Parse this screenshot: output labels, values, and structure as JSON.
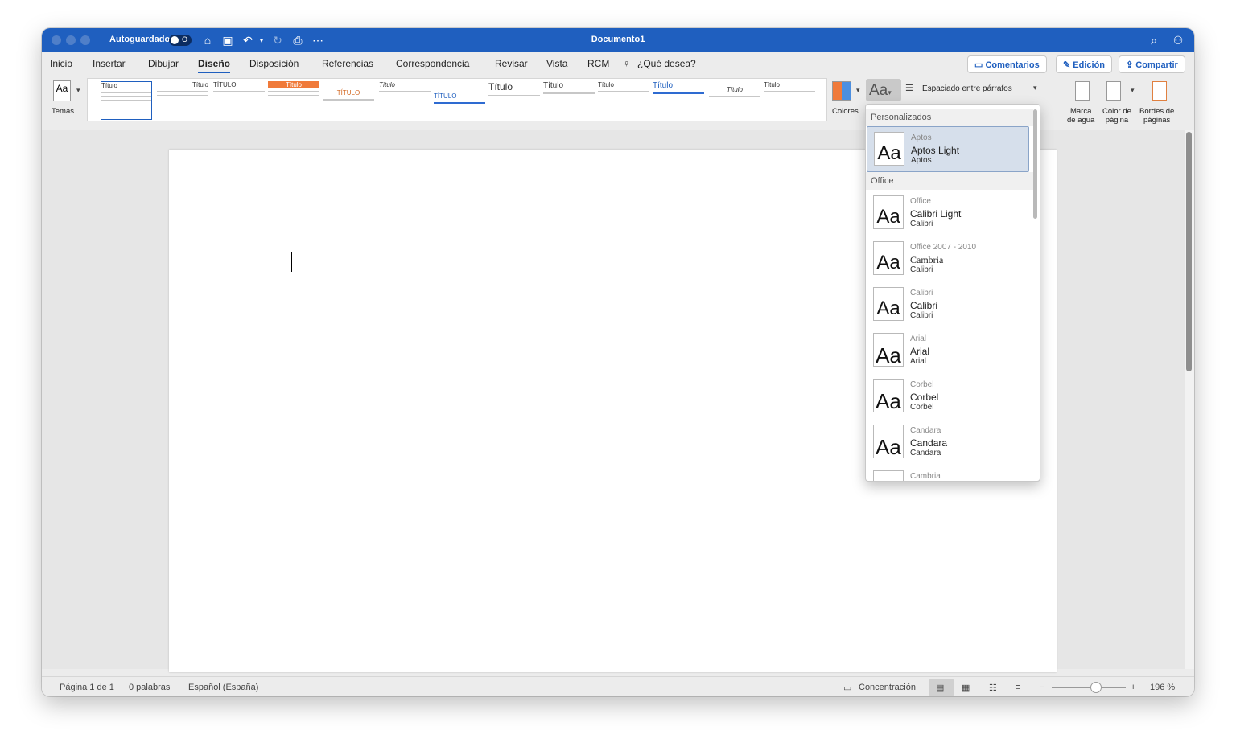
{
  "titlebar": {
    "autosave_label": "Autoguardado",
    "autosave_state": "O",
    "doc_title": "Documento1",
    "icons": [
      "home-icon",
      "save-icon",
      "undo-icon",
      "redo-icon",
      "print-icon",
      "more-icon",
      "search-icon",
      "share-person-icon"
    ]
  },
  "tabs": [
    "Inicio",
    "Insertar",
    "Dibujar",
    "Diseño",
    "Disposición",
    "Referencias",
    "Correspondencia",
    "Revisar",
    "Vista",
    "RCM"
  ],
  "active_tab": "Diseño",
  "tell_me": "¿Qué desea?",
  "top_buttons": {
    "comments": "Comentarios",
    "editing": "Edición",
    "share": "Compartir"
  },
  "ribbon": {
    "themes_label": "Temas",
    "colors_label": "Colores",
    "paragraph_spacing": "Espaciado entre párrafos",
    "watermark": [
      "Marca",
      "de agua"
    ],
    "page_color": [
      "Color de",
      "página"
    ],
    "page_borders": [
      "Bordes de",
      "páginas"
    ],
    "style_titles": [
      "Título",
      "Título",
      "TÍTULO",
      "Título",
      "TÍTULO",
      "Título",
      "TÍTULO",
      "Título",
      "Título",
      "Título",
      "Título",
      "Título",
      "Título"
    ]
  },
  "font_dropdown": {
    "section_custom": "Personalizados",
    "section_office": "Office",
    "custom_items": [
      {
        "theme": "Aptos",
        "heading": "Aptos Light",
        "body": "Aptos"
      }
    ],
    "office_items": [
      {
        "theme": "Office",
        "heading": "Calibri Light",
        "body": "Calibri"
      },
      {
        "theme": "Office 2007 - 2010",
        "heading": "Cambria",
        "body": "Calibri"
      },
      {
        "theme": "Calibri",
        "heading": "Calibri",
        "body": "Calibri"
      },
      {
        "theme": "Arial",
        "heading": "Arial",
        "body": "Arial"
      },
      {
        "theme": "Corbel",
        "heading": "Corbel",
        "body": "Corbel"
      },
      {
        "theme": "Candara",
        "heading": "Candara",
        "body": "Candara"
      },
      {
        "theme": "Cambria",
        "heading": "",
        "body": ""
      }
    ],
    "preview_glyph": "Aa"
  },
  "statusbar": {
    "page": "Página 1 de 1",
    "words": "0 palabras",
    "language": "Español (España)",
    "focus": "Concentración",
    "zoom": "196 %",
    "zoom_minus": "−",
    "zoom_plus": "+"
  },
  "colors": {
    "titlebar": "#1f5fbf",
    "accent": "#1f5fbf"
  }
}
